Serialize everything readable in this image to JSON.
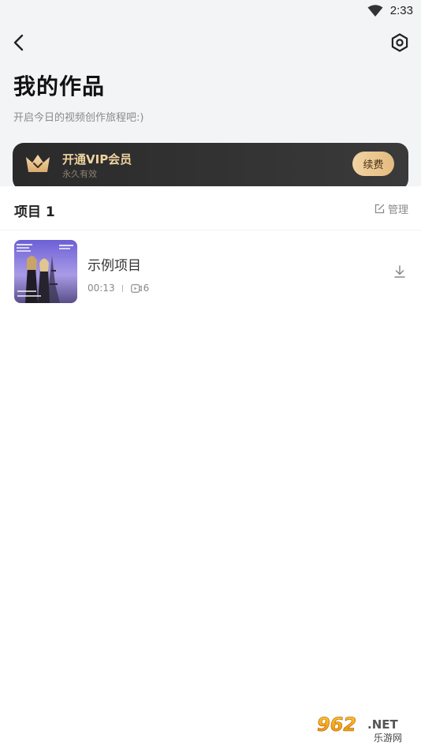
{
  "status_bar": {
    "time": "2:33"
  },
  "header": {
    "title": "我的作品",
    "subtitle": "开启今日的视频创作旅程吧:)"
  },
  "vip_banner": {
    "title": "开通VIP会员",
    "subtitle": "永久有效",
    "button_label": "续费"
  },
  "projects_section": {
    "title": "项目 1",
    "manage_label": "管理"
  },
  "projects": [
    {
      "name": "示例项目",
      "duration": "00:13",
      "clip_count": "6"
    }
  ],
  "watermark": {
    "text_main": "962",
    "text_suffix": ".NET",
    "text_sub": "乐游网"
  },
  "colors": {
    "background_top": "#f3f4f6",
    "vip_banner_bg": "#2a2a2a",
    "vip_gold": "#f0d3a1",
    "renew_button": "#e4bb80"
  }
}
